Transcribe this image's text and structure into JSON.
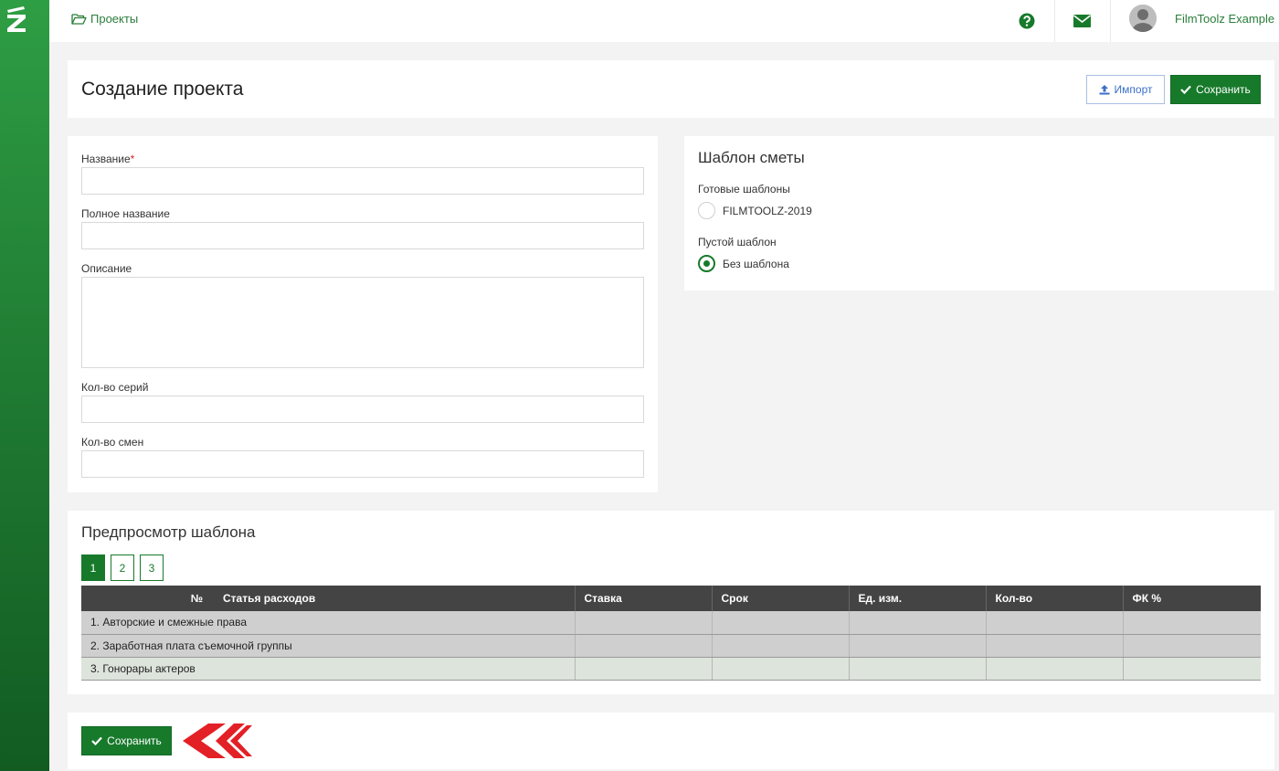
{
  "topbar": {
    "breadcrumb": "Проекты",
    "user_name": "FilmToolz Example"
  },
  "header": {
    "title": "Создание проекта",
    "import_label": "Импорт",
    "save_label": "Сохранить"
  },
  "form": {
    "name_label": "Название",
    "required_mark": "*",
    "name_value": "",
    "full_name_label": "Полное название",
    "full_name_value": "",
    "description_label": "Описание",
    "description_value": "",
    "series_label": "Кол-во серий",
    "series_value": "",
    "shifts_label": "Кол-во смен",
    "shifts_value": ""
  },
  "template": {
    "title": "Шаблон сметы",
    "ready_label": "Готовые шаблоны",
    "ready_option": "FILMTOOLZ-2019",
    "empty_label": "Пустой шаблон",
    "empty_option": "Без шаблона",
    "selected": "empty"
  },
  "preview": {
    "title": "Предпросмотр шаблона",
    "pages": [
      "1",
      "2",
      "3"
    ],
    "active_page": "1",
    "columns": [
      "№",
      "Статья расходов",
      "Ставка",
      "Срок",
      "Ед. изм.",
      "Кол-во",
      "ФК %"
    ],
    "rows": [
      "1. Авторские и смежные права",
      "2. Заработная плата съемочной группы",
      "3. Гонорары актеров"
    ]
  },
  "footer": {
    "save_label": "Сохранить"
  },
  "colors": {
    "brand_green": "#177a2b",
    "link_green": "#2a7d3a",
    "import_blue": "#3b6fc7",
    "table_header": "#444444",
    "arrow_red": "#e32026"
  }
}
